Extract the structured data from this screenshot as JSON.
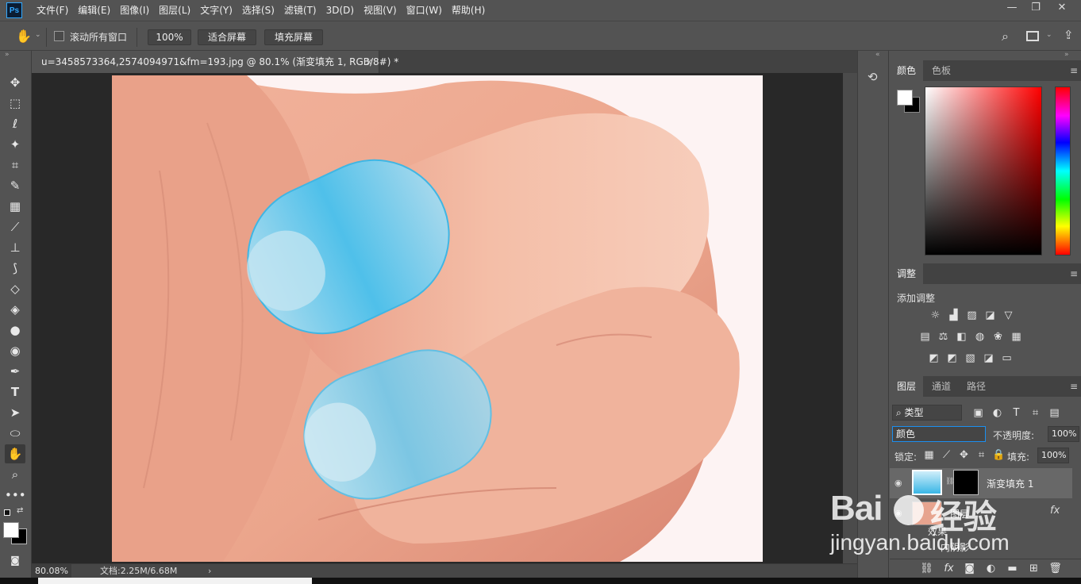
{
  "app": {
    "logo": "Ps"
  },
  "menu": [
    "文件(F)",
    "编辑(E)",
    "图像(I)",
    "图层(L)",
    "文字(Y)",
    "选择(S)",
    "滤镜(T)",
    "3D(D)",
    "视图(V)",
    "窗口(W)",
    "帮助(H)"
  ],
  "window_controls": {
    "minimize": "—",
    "restore": "❐",
    "close": "✕"
  },
  "options": {
    "scroll_all_label": "滚动所有窗口",
    "zoom_value": "100%",
    "fit_screen": "适合屏幕",
    "fill_screen": "填充屏幕"
  },
  "document": {
    "tab_title": "u=3458573364,2574094971&fm=193.jpg @ 80.1% (渐变填充 1, RGB/8#) *",
    "tab_close": "×"
  },
  "status": {
    "zoom": "80.08%",
    "doc_info": "文档:2.25M/6.68M",
    "arrow": "›"
  },
  "color_panel": {
    "tabs": [
      "颜色",
      "色板"
    ]
  },
  "adjust_panel": {
    "tab": "调整",
    "add_label": "添加调整"
  },
  "layers_panel": {
    "tabs": [
      "图层",
      "通道",
      "路径"
    ],
    "filter_kind": "类型",
    "blend_mode": "颜色",
    "opacity_label": "不透明度:",
    "opacity_value": "100%",
    "lock_label": "锁定:",
    "fill_label": "填充:",
    "fill_value": "100%",
    "layers": [
      {
        "name": "渐变填充 1"
      },
      {
        "name": "图层"
      }
    ],
    "effects_label": "效果",
    "effect_item": "内阴影",
    "fx_label": "fx"
  },
  "watermark": {
    "line1": "Bai",
    "line2": "经验",
    "url": "jingyan.baidu.com"
  },
  "colors": {
    "ps_blue": "#31a8ff",
    "panel": "#535353",
    "dark": "#424242",
    "canvas_bg": "#282828",
    "nail_blue": "#7ccde8"
  }
}
